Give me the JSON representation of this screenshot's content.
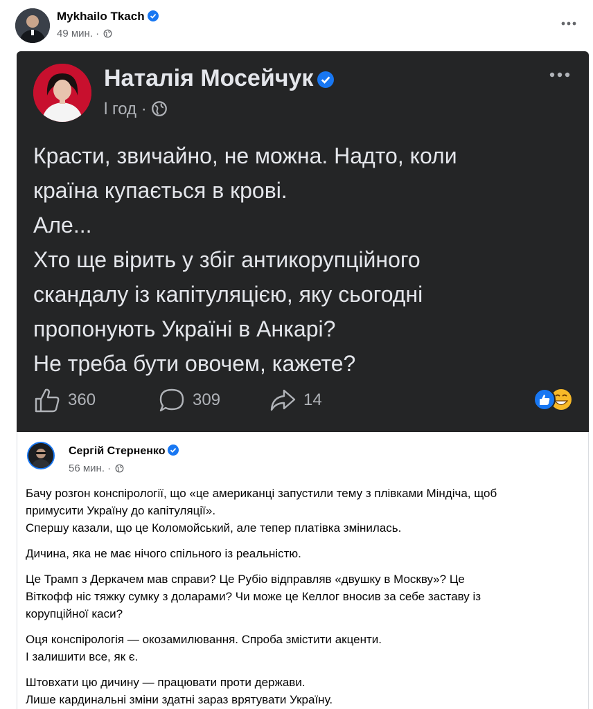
{
  "post": {
    "author": "Mykhailo Tkach",
    "time": "49 мин. ·",
    "more_icon": "more-horizontal-icon"
  },
  "shared_card": {
    "author": "Наталія Мосейчук",
    "time": "l год ·",
    "lines": [
      "Красти, звичайно, не можна. Надто, коли",
      "країна купається в крові.",
      "Але...",
      "Хто ще вірить у збіг антикорупційного",
      "скандалу із капітуляцією, яку сьогодні",
      "пропонують Україні в Анкарі?",
      "Не треба бути овочем, кажете?"
    ],
    "likes": "360",
    "comments": "309",
    "shares": "14"
  },
  "repost": {
    "author": "Сергій Стерненко",
    "time": "56 мин. ·",
    "paragraphs": [
      [
        "Бачу розгон конспірології, що «це американці запустили тему з плівками Міндіча, щоб",
        "примусити Україну до капітуляції».",
        "Спершу казали, що це Коломойський, але тепер платівка змінилась."
      ],
      [
        "Дичина, яка не має нічого спільного із реальністю."
      ],
      [
        "Це Трамп з Деркачем мав справи? Це Рубіо відправляв «двушку в Москву»? Це",
        "Віткофф ніс тяжку сумку з доларами? Чи може це Келлог вносив за себе заставу із",
        "корупційної каси?"
      ],
      [
        "Оця конспірологія — окозамилювання. Спроба змістити акценти.",
        "І залишити все, як є."
      ],
      [
        "Штовхати цю дичину — працювати проти держави.",
        "Лише кардинальні зміни здатні зараз врятувати Україну."
      ]
    ]
  },
  "colors": {
    "card_bg": "#242526",
    "verified": "#1877f2",
    "secondary_text": "#65676b"
  }
}
